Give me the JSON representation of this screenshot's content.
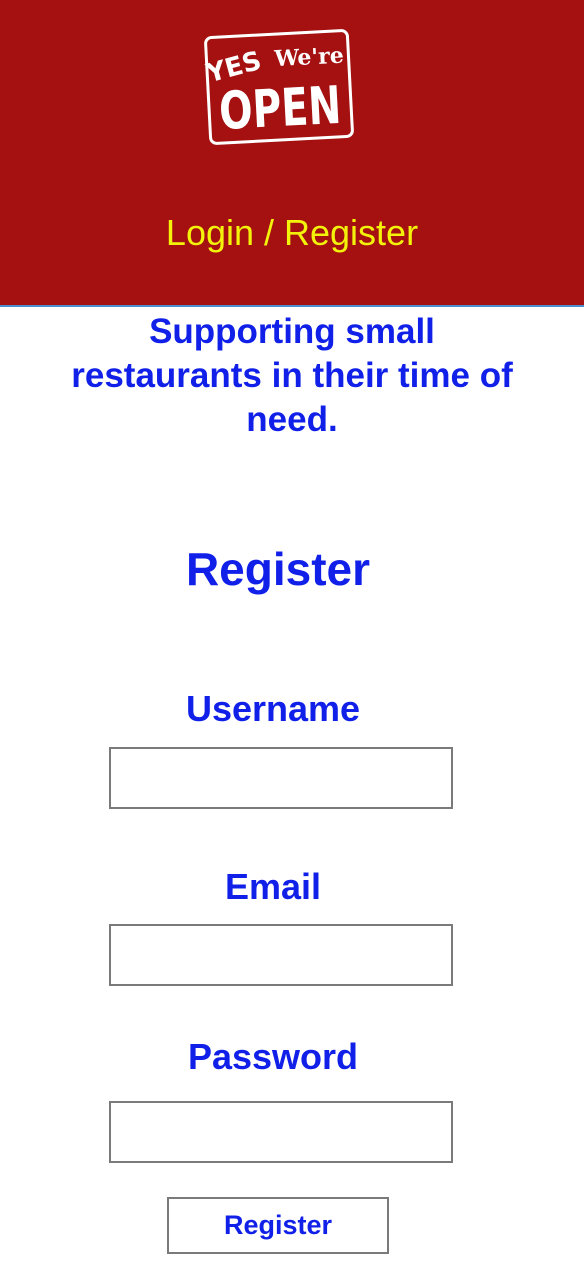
{
  "header": {
    "logo": {
      "yes_text": "YES",
      "were_text": "We're",
      "open_text": "OPEN"
    },
    "nav_link": "Login / Register",
    "bg_color": "#a51010",
    "link_color": "#f2f20a"
  },
  "tagline": "Supporting small restaurants in their time of need.",
  "form": {
    "title": "Register",
    "fields": [
      {
        "label": "Username",
        "value": "",
        "placeholder": ""
      },
      {
        "label": "Email",
        "value": "",
        "placeholder": ""
      },
      {
        "label": "Password",
        "value": "",
        "placeholder": ""
      }
    ],
    "submit_label": "Register",
    "accent_color": "#1020e8"
  }
}
